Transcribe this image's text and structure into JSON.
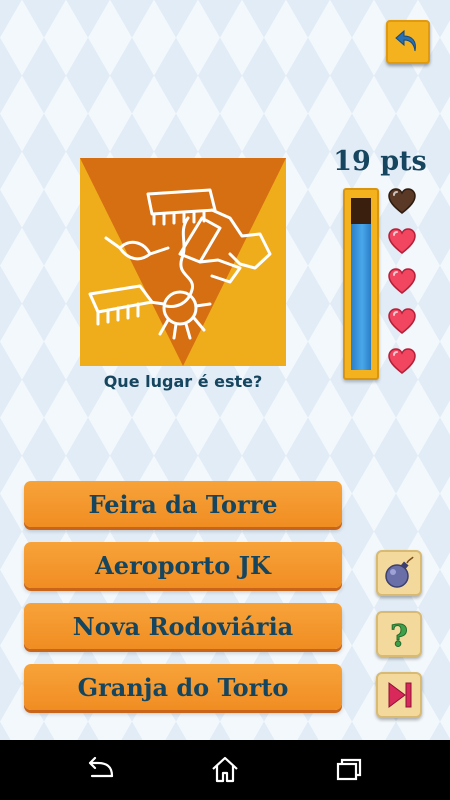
{
  "score": {
    "value": 19,
    "label": "19 pts"
  },
  "question": {
    "text": "Que lugar é este?"
  },
  "answers": [
    {
      "label": "Feira da Torre"
    },
    {
      "label": "Aeroporto JK"
    },
    {
      "label": "Nova Rodoviária"
    },
    {
      "label": "Granja do Torto"
    }
  ],
  "timer": {
    "fraction_remaining": 0.85
  },
  "lives": {
    "total": 5,
    "remaining": 4
  },
  "icons": {
    "back": "back-arrow-icon",
    "powerups": [
      "bomb-icon",
      "question-mark-icon",
      "skip-icon"
    ],
    "nav": [
      "nav-back-icon",
      "nav-home-icon",
      "nav-recents-icon"
    ]
  },
  "colors": {
    "text": "#16465f",
    "answer_button": "#f5992e",
    "timer_fill": "#3d9be0",
    "heart": "#f2455f",
    "heart_lost": "#5a3a26"
  }
}
